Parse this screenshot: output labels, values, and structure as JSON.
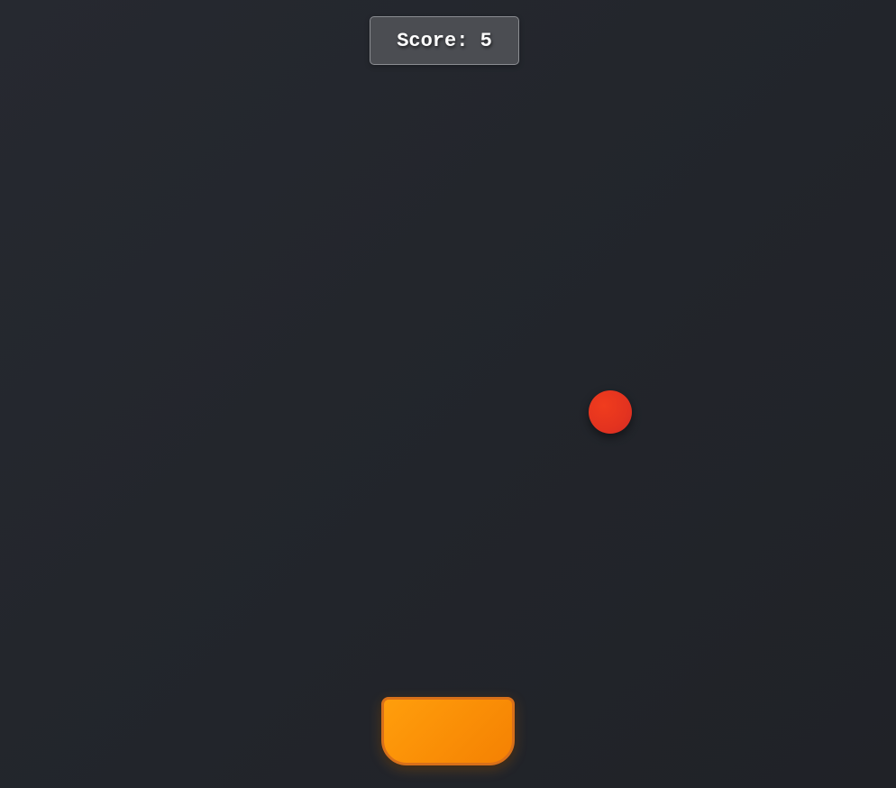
{
  "hud": {
    "score_label": "Score:",
    "score_value": "5"
  },
  "objects": {
    "ball": {
      "icon": "ball-icon",
      "color": "#e3331f"
    },
    "paddle": {
      "icon": "paddle-icon",
      "color": "#fa8e06"
    }
  },
  "colors": {
    "background": "#23262c",
    "score_box": "#4b4d52",
    "score_text": "#ffffff"
  }
}
